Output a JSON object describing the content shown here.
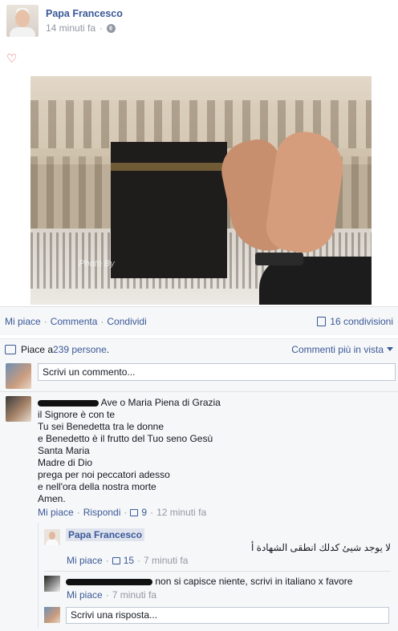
{
  "post": {
    "author": "Papa Francesco",
    "time": "14 minuti fa",
    "privacy_icon": "globe-icon",
    "reaction_icon": "heart-icon",
    "photo_watermark": "Photo By"
  },
  "actions": {
    "like": "Mi piace",
    "comment": "Commenta",
    "share": "Condividi",
    "separator": "·",
    "shares_count": "16 condivisioni"
  },
  "likes": {
    "text_prefix": "Piace a ",
    "count": "239 persone",
    "text_suffix": ".",
    "sort_label": "Commenti più in vista"
  },
  "comment_input": {
    "placeholder": "Scrivi un commento..."
  },
  "comments": [
    {
      "text_lines": [
        "Ave o Maria Piena di Grazia",
        "il Signore è con te",
        "Tu sei Benedetta tra le donne",
        "e Benedetto è il frutto del Tuo seno Gesù",
        "Santa Maria",
        "Madre di Dio",
        "prega per noi peccatori adesso",
        "e nell'ora della nostra morte",
        "Amen."
      ],
      "like": "Mi piace",
      "reply": "Rispondi",
      "like_count": "9",
      "time": "12 minuti fa"
    }
  ],
  "replies": [
    {
      "author": "Papa Francesco",
      "text": "لا يوجد شيئ كدلك انطقى الشهادة أ",
      "like": "Mi piace",
      "like_count": "15",
      "time": "7 minuti fa"
    },
    {
      "text": "non si capisce niente, scrivi in italiano x favore",
      "like": "Mi piace",
      "time": "7 minuti fa"
    }
  ],
  "reply_input": {
    "placeholder": "Scrivi una risposta..."
  }
}
